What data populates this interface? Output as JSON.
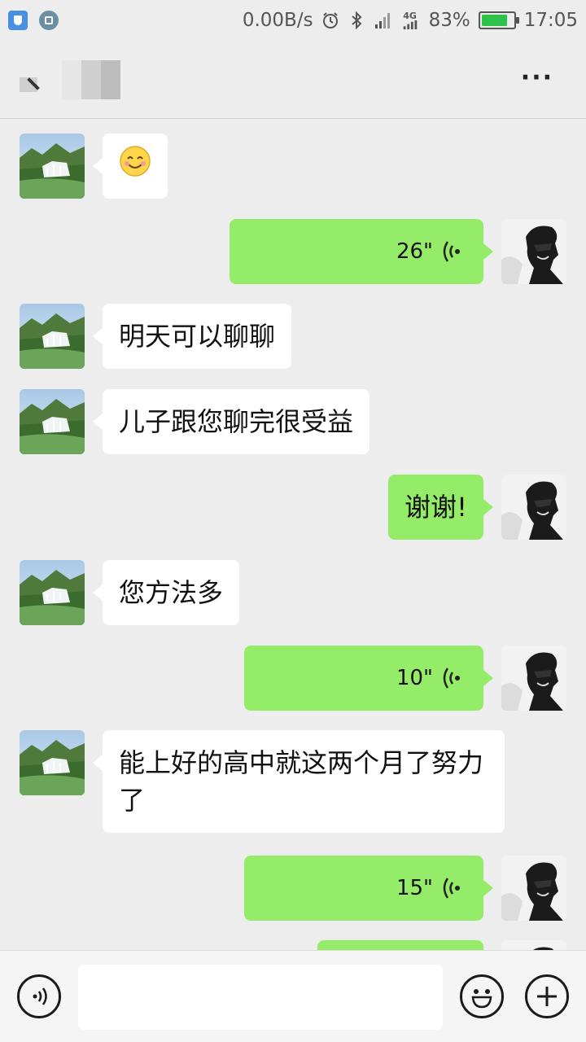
{
  "status_bar": {
    "net_speed": "0.00B/s",
    "network": "4G",
    "battery_percent": "83%",
    "battery_level": 0.83,
    "time": "17:05"
  },
  "header": {
    "menu_icon": "more-dots-icon"
  },
  "messages": [
    {
      "side": "in",
      "type": "emoji",
      "text": "😊"
    },
    {
      "side": "out",
      "type": "voice",
      "duration": "26\""
    },
    {
      "side": "in",
      "type": "text",
      "text": "明天可以聊聊"
    },
    {
      "side": "in",
      "type": "text",
      "text": "儿子跟您聊完很受益"
    },
    {
      "side": "out",
      "type": "text",
      "text": "谢谢!"
    },
    {
      "side": "in",
      "type": "text",
      "text": "您方法多"
    },
    {
      "side": "out",
      "type": "voice",
      "duration": "10\""
    },
    {
      "side": "in",
      "type": "text",
      "text": "能上好的高中就这两个月了努力了"
    },
    {
      "side": "out",
      "type": "voice",
      "duration": "15\""
    }
  ],
  "input_bar": {
    "voice_button_icon": "voice-input-icon",
    "emoji_button_icon": "emoji-icon",
    "plus_button_icon": "plus-icon",
    "placeholder": ""
  },
  "colors": {
    "background": "#ededed",
    "outgoing_bubble": "#95ec69",
    "incoming_bubble": "#ffffff"
  }
}
